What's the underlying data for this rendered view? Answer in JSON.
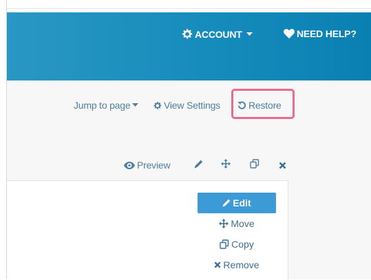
{
  "header": {
    "account_label": "ACCOUNT",
    "help_label": "NEED HELP?"
  },
  "toolbar": {
    "jump_label": "Jump to page",
    "view_settings_label": "View Settings",
    "restore_label": "Restore"
  },
  "question_actions": {
    "preview_label": "Preview"
  },
  "menu": {
    "items": [
      {
        "label": "Edit",
        "icon": "pencil-icon",
        "active": true
      },
      {
        "label": "Move",
        "icon": "move-icon",
        "active": false
      },
      {
        "label": "Copy",
        "icon": "copy-icon",
        "active": false
      },
      {
        "label": "Remove",
        "icon": "close-icon",
        "active": false
      }
    ]
  },
  "colors": {
    "header_bg": "#168cbc",
    "link": "#4f7f9f",
    "highlight_border": "#e96a8d",
    "active_item_bg": "#3c9ad6"
  }
}
